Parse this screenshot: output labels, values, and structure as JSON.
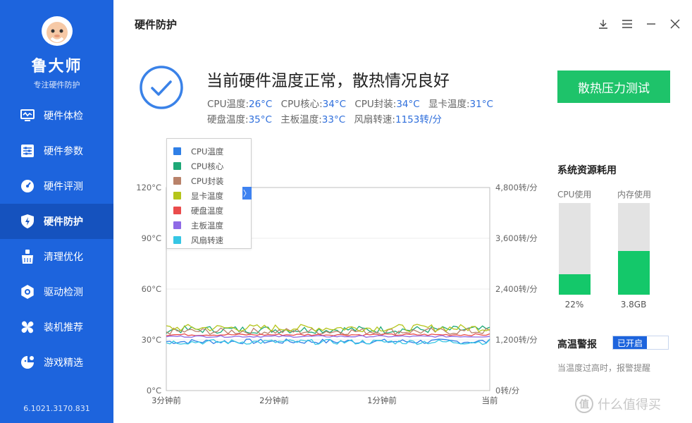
{
  "app": {
    "brand": "鲁大师",
    "brand_sub": "专注硬件防护",
    "version": "6.1021.3170.831"
  },
  "sidebar": {
    "items": [
      {
        "label": "硬件体检",
        "icon": "monitor-check-icon"
      },
      {
        "label": "硬件参数",
        "icon": "sliders-icon"
      },
      {
        "label": "硬件评测",
        "icon": "speedometer-icon"
      },
      {
        "label": "硬件防护",
        "icon": "shield-bolt-icon",
        "active": true
      },
      {
        "label": "清理优化",
        "icon": "broom-icon"
      },
      {
        "label": "驱动检测",
        "icon": "gear-icon"
      },
      {
        "label": "装机推荐",
        "icon": "fan-icon"
      },
      {
        "label": "游戏精选",
        "icon": "game-icon"
      }
    ]
  },
  "header": {
    "title": "硬件防护",
    "window_buttons": [
      "download-icon",
      "menu-icon",
      "minimize-icon",
      "close-icon"
    ]
  },
  "status": {
    "title": "当前硬件温度正常，散热情况良好",
    "stats": [
      {
        "label": "CPU温度:",
        "value": "26°C"
      },
      {
        "label": "CPU核心:",
        "value": "34°C"
      },
      {
        "label": "CPU封装:",
        "value": "34°C"
      },
      {
        "label": "显卡温度:",
        "value": "31°C"
      },
      {
        "label": "硬盘温度:",
        "value": "35°C"
      },
      {
        "label": "主板温度:",
        "value": "33°C"
      },
      {
        "label": "风扇转速:",
        "value": "1153转/分"
      }
    ],
    "stress_button": "散热压力测试"
  },
  "chart_data": {
    "type": "line",
    "x_labels": [
      "3分钟前",
      "2分钟前",
      "1分钟前",
      "当前"
    ],
    "y_left_ticks": [
      "0°C",
      "30°C",
      "60°C",
      "90°C",
      "120°C"
    ],
    "y_right_ticks": [
      "0转/分",
      "1,200转/分",
      "2,400转/分",
      "3,600转/分",
      "4,800转/分"
    ],
    "ylim_left": [
      0,
      120
    ],
    "ylim_right": [
      0,
      4800
    ],
    "points_per_series": 90,
    "grid": true,
    "legend_position": "top-left",
    "series": [
      {
        "name": "CPU温度",
        "color": "#2f7fe6",
        "axis": "left",
        "base": 29,
        "jitter": 1.5
      },
      {
        "name": "CPU核心",
        "color": "#1ea877",
        "axis": "left",
        "base": 36,
        "jitter": 2.2
      },
      {
        "name": "CPU封装",
        "color": "#b9826a",
        "axis": "left",
        "base": 35,
        "jitter": 2.0
      },
      {
        "name": "显卡温度",
        "color": "#b5c51b",
        "axis": "left",
        "base": 37,
        "jitter": 2.2
      },
      {
        "name": "硬盘温度",
        "color": "#ea4c4c",
        "axis": "left",
        "base": 33,
        "jitter": 0.6
      },
      {
        "name": "主板温度",
        "color": "#8f6ae6",
        "axis": "left",
        "base": 32,
        "jitter": 0.5
      },
      {
        "name": "风扇转速",
        "color": "#36c6e4",
        "axis": "right",
        "base": 1150,
        "jitter": 60
      }
    ]
  },
  "resources": {
    "title": "系统资源耗用",
    "cpu": {
      "label": "CPU使用",
      "value": "22%",
      "fraction": 0.22
    },
    "mem": {
      "label": "内存使用",
      "value": "3.8GB",
      "fraction": 0.48
    }
  },
  "alarm": {
    "title": "高温警报",
    "toggle": "已开启",
    "desc": "当温度过高时，报警提醒"
  },
  "watermark": {
    "glyph": "值",
    "text": "什么值得买"
  }
}
